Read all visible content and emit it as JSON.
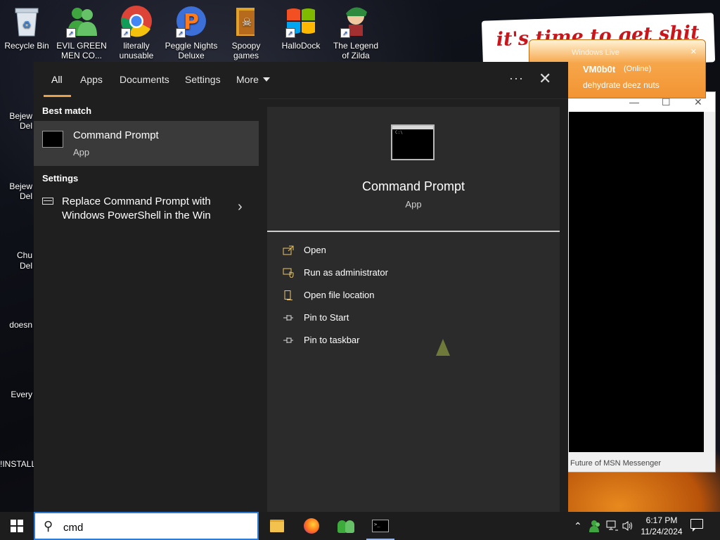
{
  "desktop": {
    "icons": [
      {
        "label": "Recycle Bin",
        "icon": "recycle-bin-icon"
      },
      {
        "label": "EVIL GREEN MEN CO...",
        "icon": "msn-people-icon"
      },
      {
        "label": "literally unusable",
        "icon": "chrome-icon"
      },
      {
        "label": "Peggle Nights Deluxe",
        "icon": "peggle-icon"
      },
      {
        "label": "Spoopy games",
        "icon": "folder-icon"
      },
      {
        "label": "HalloDock",
        "icon": "windows-logo-icon"
      },
      {
        "label": "The Legend of Zilda",
        "icon": "zelda-icon"
      }
    ],
    "peek_labels": [
      "Bejew",
      "Del",
      "Bejew",
      "Del",
      "Chu",
      "Del",
      "doesn",
      "Every",
      "!INSTALL"
    ],
    "banner_text": "it's time to get shit",
    "colors": {
      "accent": "#e8a04b",
      "searchbox_border": "#2f7ad3",
      "msn_orange": "#f29433"
    }
  },
  "msn": {
    "title": "Windows Live",
    "username": "VM0b0t",
    "status": "(Online)",
    "message": "dehydrate deez nuts",
    "footer": "Future of MSN Messenger"
  },
  "search": {
    "tabs": [
      {
        "label": "All",
        "active": true
      },
      {
        "label": "Apps"
      },
      {
        "label": "Documents"
      },
      {
        "label": "Settings"
      },
      {
        "label": "More"
      }
    ],
    "ellipsis": "···",
    "close": "✕",
    "best_match_heading": "Best match",
    "best_match": {
      "title": "Command Prompt",
      "subtitle": "App",
      "icon": "cmd-icon"
    },
    "settings_heading": "Settings",
    "setting_item": {
      "label": "Replace Command Prompt with Windows PowerShell in the Win",
      "chevron": "›"
    },
    "preview": {
      "title": "Command Prompt",
      "subtitle": "App",
      "actions": [
        {
          "label": "Open",
          "icon": "open-icon"
        },
        {
          "label": "Run as administrator",
          "icon": "shield-icon"
        },
        {
          "label": "Open file location",
          "icon": "file-location-icon"
        },
        {
          "label": "Pin to Start",
          "icon": "pin-icon"
        },
        {
          "label": "Pin to taskbar",
          "icon": "pin-icon"
        }
      ]
    }
  },
  "taskbar": {
    "search_value": "cmd",
    "apps": [
      "file-explorer-icon",
      "firefox-icon",
      "msn-messenger-icon",
      "command-prompt-icon"
    ],
    "clock_time": "6:17 PM",
    "clock_date": "11/24/2024"
  }
}
